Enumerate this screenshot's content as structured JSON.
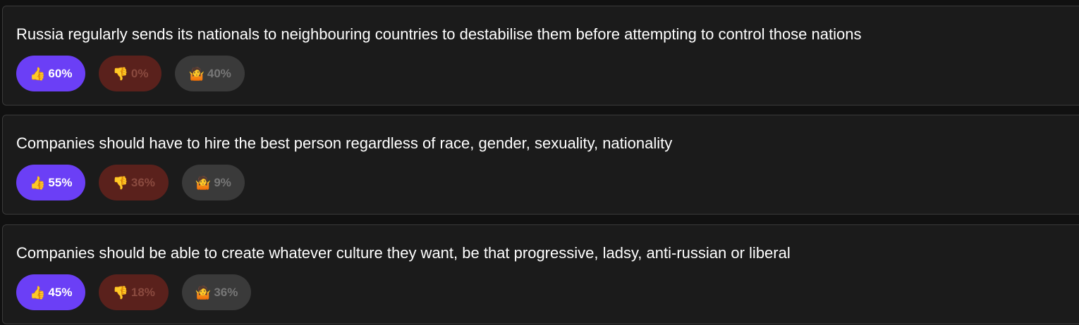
{
  "statements": [
    {
      "text": "Russia regularly sends its nationals to neighbouring countries to destabilise them before attempting to control those nations",
      "agree": "60%",
      "disagree": "0%",
      "unsure": "40%"
    },
    {
      "text": "Companies should have to hire the best person regardless of race, gender, sexuality, nationality",
      "agree": "55%",
      "disagree": "36%",
      "unsure": "9%"
    },
    {
      "text": "Companies should be able to create whatever culture they want, be that progressive, ladsy, anti-russian or liberal",
      "agree": "45%",
      "disagree": "18%",
      "unsure": "36%"
    }
  ],
  "icons": {
    "agree": "thumbs-up-icon",
    "disagree": "thumbs-down-icon",
    "unsure": "shrug-icon"
  },
  "colors": {
    "agree_bg": "#6b3ff6",
    "disagree_bg": "#5a211c",
    "unsure_bg": "#3a3a3a",
    "card_bg": "#1b1b1b"
  }
}
